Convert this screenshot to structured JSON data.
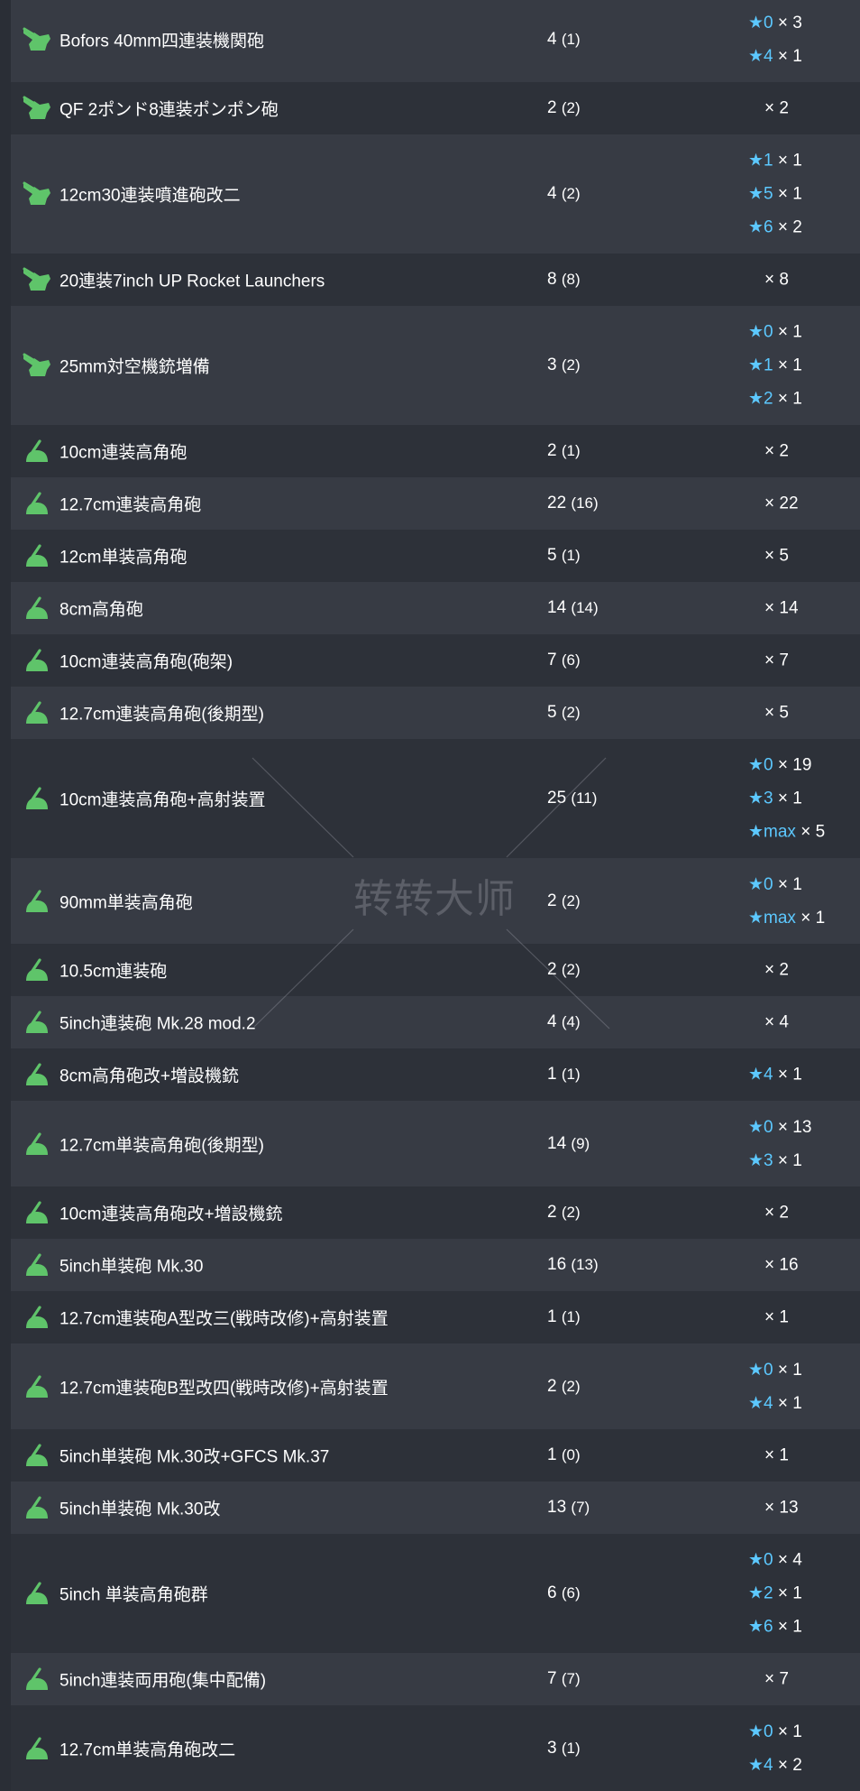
{
  "rows": [
    {
      "name": "Bofors 40mm四連装機関砲",
      "count": "4",
      "sub": "(1)",
      "icon": "aa-gun-icon",
      "stars": [
        {
          "lv": "★0",
          "n": "× 3"
        },
        {
          "lv": "★4",
          "n": "× 1"
        }
      ]
    },
    {
      "name": "QF 2ポンド8連装ポンポン砲",
      "count": "2",
      "sub": "(2)",
      "icon": "aa-gun-icon",
      "plain": "× 2"
    },
    {
      "name": "12cm30連装噴進砲改二",
      "count": "4",
      "sub": "(2)",
      "icon": "aa-gun-icon",
      "stars": [
        {
          "lv": "★1",
          "n": "× 1"
        },
        {
          "lv": "★5",
          "n": "× 1"
        },
        {
          "lv": "★6",
          "n": "× 2"
        }
      ]
    },
    {
      "name": "20連装7inch UP Rocket Launchers",
      "count": "8",
      "sub": "(8)",
      "icon": "aa-gun-icon",
      "plain": "× 8"
    },
    {
      "name": "25mm対空機銃増備",
      "count": "3",
      "sub": "(2)",
      "icon": "aa-gun-icon",
      "stars": [
        {
          "lv": "★0",
          "n": "× 1"
        },
        {
          "lv": "★1",
          "n": "× 1"
        },
        {
          "lv": "★2",
          "n": "× 1"
        }
      ]
    },
    {
      "name": "10cm連装高角砲",
      "count": "2",
      "sub": "(1)",
      "icon": "ha-gun-icon",
      "plain": "× 2"
    },
    {
      "name": "12.7cm連装高角砲",
      "count": "22",
      "sub": "(16)",
      "icon": "ha-gun-icon",
      "plain": "× 22"
    },
    {
      "name": "12cm単装高角砲",
      "count": "5",
      "sub": "(1)",
      "icon": "ha-gun-icon",
      "plain": "× 5"
    },
    {
      "name": "8cm高角砲",
      "count": "14",
      "sub": "(14)",
      "icon": "ha-gun-icon",
      "plain": "× 14"
    },
    {
      "name": "10cm連装高角砲(砲架)",
      "count": "7",
      "sub": "(6)",
      "icon": "ha-gun-icon",
      "plain": "× 7"
    },
    {
      "name": "12.7cm連装高角砲(後期型)",
      "count": "5",
      "sub": "(2)",
      "icon": "ha-gun-icon",
      "plain": "× 5"
    },
    {
      "name": "10cm連装高角砲+高射装置",
      "count": "25",
      "sub": "(11)",
      "icon": "ha-gun-icon",
      "stars": [
        {
          "lv": "★0",
          "n": "× 19"
        },
        {
          "lv": "★3",
          "n": "× 1"
        },
        {
          "lv": "★max",
          "n": "× 5"
        }
      ]
    },
    {
      "name": "90mm単装高角砲",
      "count": "2",
      "sub": "(2)",
      "icon": "ha-gun-icon",
      "stars": [
        {
          "lv": "★0",
          "n": "× 1"
        },
        {
          "lv": "★max",
          "n": "× 1"
        }
      ]
    },
    {
      "name": "10.5cm連装砲",
      "count": "2",
      "sub": "(2)",
      "icon": "ha-gun-icon",
      "plain": "× 2"
    },
    {
      "name": "5inch連装砲 Mk.28 mod.2",
      "count": "4",
      "sub": "(4)",
      "icon": "ha-gun-icon",
      "plain": "× 4"
    },
    {
      "name": "8cm高角砲改+増設機銃",
      "count": "1",
      "sub": "(1)",
      "icon": "ha-gun-icon",
      "stars": [
        {
          "lv": "★4",
          "n": "× 1"
        }
      ]
    },
    {
      "name": "12.7cm単装高角砲(後期型)",
      "count": "14",
      "sub": "(9)",
      "icon": "ha-gun-icon",
      "stars": [
        {
          "lv": "★0",
          "n": "× 13"
        },
        {
          "lv": "★3",
          "n": "× 1"
        }
      ]
    },
    {
      "name": "10cm連装高角砲改+増設機銃",
      "count": "2",
      "sub": "(2)",
      "icon": "ha-gun-icon",
      "plain": "× 2"
    },
    {
      "name": "5inch単装砲 Mk.30",
      "count": "16",
      "sub": "(13)",
      "icon": "ha-gun-icon",
      "plain": "× 16"
    },
    {
      "name": "12.7cm連装砲A型改三(戦時改修)+高射装置",
      "count": "1",
      "sub": "(1)",
      "icon": "ha-gun-icon",
      "plain": "× 1"
    },
    {
      "name": "12.7cm連装砲B型改四(戦時改修)+高射装置",
      "count": "2",
      "sub": "(2)",
      "icon": "ha-gun-icon",
      "stars": [
        {
          "lv": "★0",
          "n": "× 1"
        },
        {
          "lv": "★4",
          "n": "× 1"
        }
      ]
    },
    {
      "name": "5inch単装砲 Mk.30改+GFCS Mk.37",
      "count": "1",
      "sub": "(0)",
      "icon": "ha-gun-icon",
      "plain": "× 1"
    },
    {
      "name": "5inch単装砲 Mk.30改",
      "count": "13",
      "sub": "(7)",
      "icon": "ha-gun-icon",
      "plain": "× 13"
    },
    {
      "name": "5inch 単装高角砲群",
      "count": "6",
      "sub": "(6)",
      "icon": "ha-gun-icon",
      "stars": [
        {
          "lv": "★0",
          "n": "× 4"
        },
        {
          "lv": "★2",
          "n": "× 1"
        },
        {
          "lv": "★6",
          "n": "× 1"
        }
      ]
    },
    {
      "name": "5inch連装両用砲(集中配備)",
      "count": "7",
      "sub": "(7)",
      "icon": "ha-gun-icon",
      "plain": "× 7"
    },
    {
      "name": "12.7cm単装高角砲改二",
      "count": "3",
      "sub": "(1)",
      "icon": "ha-gun-icon",
      "stars": [
        {
          "lv": "★0",
          "n": "× 1"
        },
        {
          "lv": "★4",
          "n": "× 2"
        }
      ]
    }
  ],
  "watermark": "转转大师",
  "colors": {
    "row_odd": "#373b44",
    "row_even": "#2d3139",
    "star": "#5cc8ff",
    "icon_green": "#5fc46a"
  }
}
